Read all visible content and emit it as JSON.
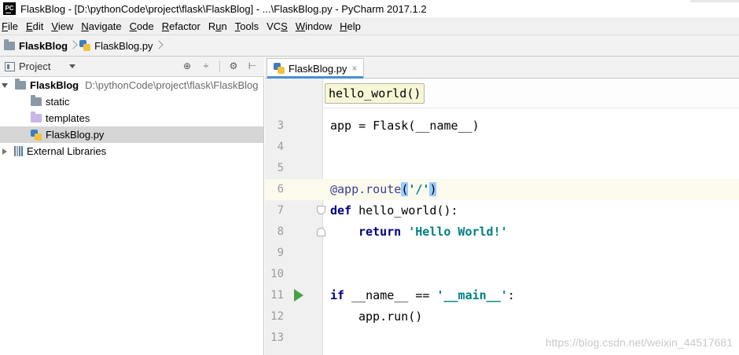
{
  "window": {
    "title": "FlaskBlog - [D:\\pythonCode\\project\\flask\\FlaskBlog] - ...\\FlaskBlog.py - PyCharm 2017.1.2",
    "logo": "PC"
  },
  "menu": [
    {
      "prefix": "",
      "u": "F",
      "rest": "ile"
    },
    {
      "prefix": "",
      "u": "E",
      "rest": "dit"
    },
    {
      "prefix": "",
      "u": "V",
      "rest": "iew"
    },
    {
      "prefix": "",
      "u": "N",
      "rest": "avigate"
    },
    {
      "prefix": "",
      "u": "C",
      "rest": "ode"
    },
    {
      "prefix": "",
      "u": "R",
      "rest": "efactor"
    },
    {
      "prefix": "R",
      "u": "u",
      "rest": "n"
    },
    {
      "prefix": "",
      "u": "T",
      "rest": "ools"
    },
    {
      "prefix": "VC",
      "u": "S",
      "rest": ""
    },
    {
      "prefix": "",
      "u": "W",
      "rest": "indow"
    },
    {
      "prefix": "",
      "u": "H",
      "rest": "elp"
    }
  ],
  "breadcrumb": {
    "project": "FlaskBlog",
    "file": "FlaskBlog.py"
  },
  "project_panel": {
    "label": "Project",
    "root": {
      "name": "FlaskBlog",
      "path": "D:\\pythonCode\\project\\flask\\FlaskBlog"
    },
    "items": [
      {
        "name": "static"
      },
      {
        "name": "templates"
      },
      {
        "name": "FlaskBlog.py"
      }
    ],
    "external": "External Libraries"
  },
  "editor": {
    "tab_label": "FlaskBlog.py",
    "tab_close": "×",
    "tooltip": "hello_world()",
    "line_numbers": [
      "3",
      "4",
      "5",
      "6",
      "7",
      "8",
      "9",
      "10",
      "11",
      "12",
      "13"
    ]
  },
  "code": {
    "l3": "app = Flask(__name__)",
    "l6_deco": "@app.route",
    "l6_open": "(",
    "l6_str": "'/'",
    "l6_close": ")",
    "l7_kw": "def",
    "l7_rest": " hello_world():",
    "l8_kw": "return",
    "l8_str": "'Hello World!'",
    "l11_kw": "if",
    "l11_mid": " __name__ == ",
    "l11_str": "'__main__'",
    "l11_end": ":",
    "l12": "app.run()"
  },
  "watermark": "https://blog.csdn.net/weixin_44517681",
  "colors": {
    "keyword": "#000080",
    "string": "#008080",
    "run_icon": "#48a048",
    "current_line": "#fcfaed",
    "tooltip_bg": "#f7f7d7"
  },
  "icons": [
    "pycharm-logo-icon",
    "folder-icon",
    "python-file-icon",
    "project-view-icon",
    "gear-icon",
    "run-gutter-icon",
    "library-icon"
  ]
}
